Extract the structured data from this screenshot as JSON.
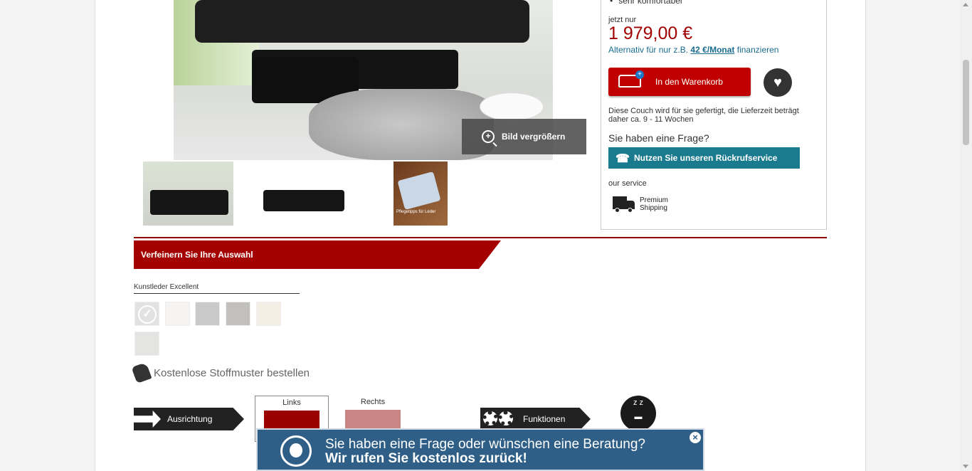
{
  "product": {
    "bullet": "sehr komfortabel",
    "price_prefix": "jetzt nur",
    "price": "1 979,00 €",
    "finance_text": "Alternativ für nur z.B.",
    "finance_amount": "42 €/Monat",
    "finance_suffix": "finanzieren",
    "cart_button": "In den Warenkorb",
    "delivery_note": "Diese Couch wird für sie gefertigt, die Lieferzeit beträgt daher ca. 9 - 11 Wochen",
    "question_heading": "Sie haben eine Frage?",
    "callback_button": "Nutzen Sie unseren Rückrufservice",
    "service_heading": "our service",
    "service_item": "Premium Shipping"
  },
  "gallery": {
    "zoom_label": "Bild vergrößern",
    "thumb3_caption": "Pflegetipps für Leder"
  },
  "refine": {
    "heading": "Verfeinern Sie Ihre Auswahl",
    "material_label": "Kunstleder Excellent",
    "fabric_samples": "Kostenlose Stoffmuster bestellen"
  },
  "options": {
    "orientation_label": "Ausrichtung",
    "left_label": "Links",
    "right_label": "Rechts",
    "functions_label": "Funktionen"
  },
  "callback_banner": {
    "line1": "Sie haben eine Frage oder wünschen eine Beratung?",
    "line2": "Wir rufen Sie kostenlos zurück!"
  },
  "colors": {
    "price": "#a10000",
    "cart_button": "#c00000",
    "callback": "#1a7b8f",
    "banner": "#2f5f86"
  }
}
